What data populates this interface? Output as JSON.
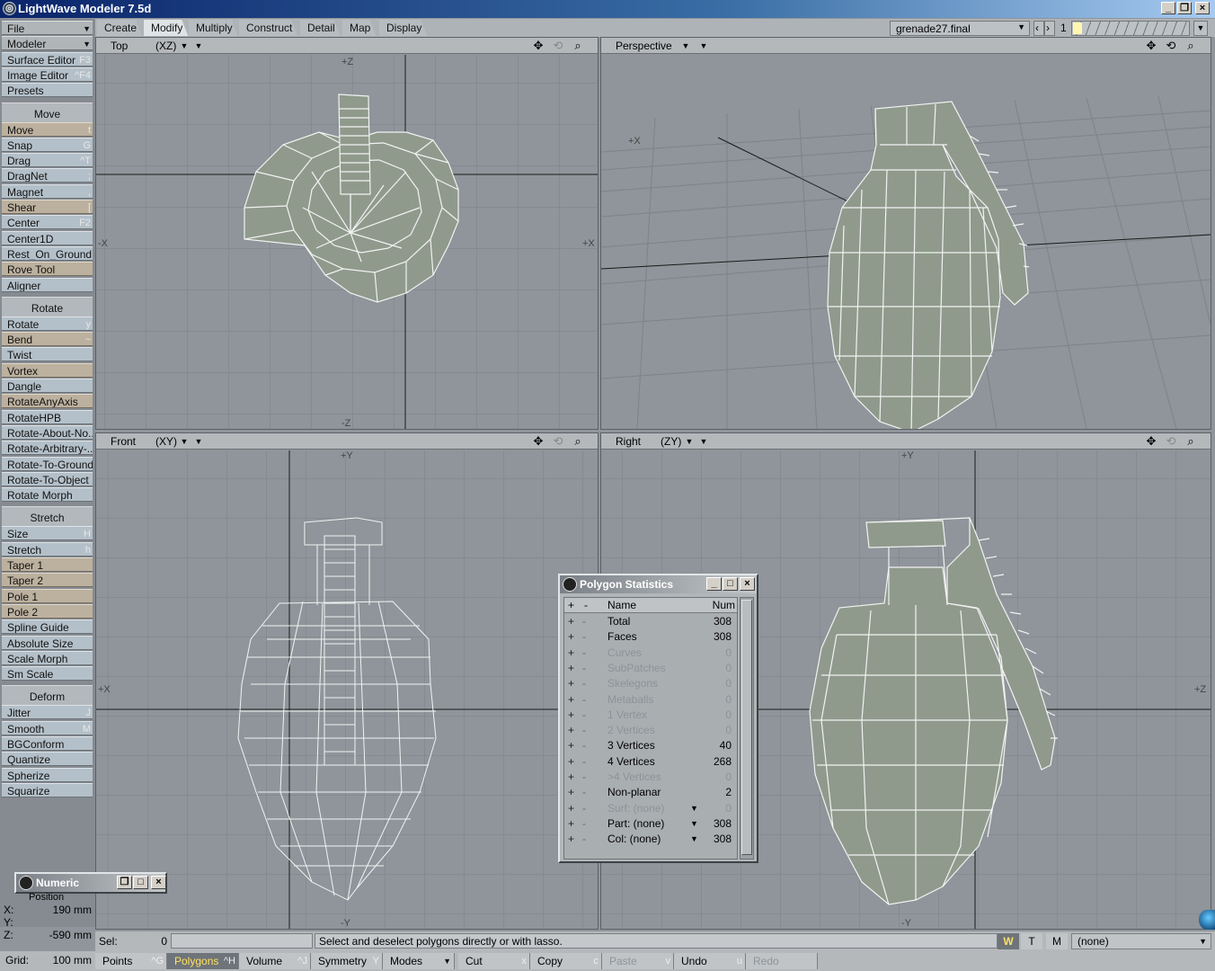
{
  "window": {
    "title": "LightWave Modeler 7.5d"
  },
  "tabs": [
    "Create",
    "Modify",
    "Multiply",
    "Construct",
    "Detail",
    "Map",
    "Display"
  ],
  "active_tab": "Modify",
  "scene": {
    "object": "grenade27.final",
    "layer": "1"
  },
  "sidebar": {
    "top": [
      {
        "label": "File",
        "shortcut": ""
      },
      {
        "label": "Modeler",
        "shortcut": ""
      },
      {
        "label": "Surface Editor",
        "shortcut": "F3"
      },
      {
        "label": "Image Editor",
        "shortcut": "^F4"
      },
      {
        "label": "Presets",
        "shortcut": ""
      }
    ],
    "move_header": "Move",
    "move": [
      {
        "label": "Move",
        "shortcut": "t"
      },
      {
        "label": "Snap",
        "shortcut": "G"
      },
      {
        "label": "Drag",
        "shortcut": "^T"
      },
      {
        "label": "DragNet",
        "shortcut": ";"
      },
      {
        "label": "Magnet",
        "shortcut": ","
      },
      {
        "label": "Shear",
        "shortcut": "["
      },
      {
        "label": "Center",
        "shortcut": "F2"
      },
      {
        "label": "Center1D",
        "shortcut": ""
      },
      {
        "label": "Rest_On_Ground",
        "shortcut": ""
      },
      {
        "label": "Rove Tool",
        "shortcut": ""
      },
      {
        "label": "Aligner",
        "shortcut": ""
      }
    ],
    "rotate_header": "Rotate",
    "rotate": [
      {
        "label": "Rotate",
        "shortcut": "y"
      },
      {
        "label": "Bend",
        "shortcut": "~"
      },
      {
        "label": "Twist",
        "shortcut": ""
      },
      {
        "label": "Vortex",
        "shortcut": ""
      },
      {
        "label": "Dangle",
        "shortcut": ""
      },
      {
        "label": "RotateAnyAxis",
        "shortcut": ""
      },
      {
        "label": "RotateHPB",
        "shortcut": ""
      },
      {
        "label": "Rotate-About-No...",
        "shortcut": ""
      },
      {
        "label": "Rotate-Arbitrary-...",
        "shortcut": ""
      },
      {
        "label": "Rotate-To-Ground",
        "shortcut": ""
      },
      {
        "label": "Rotate-To-Object",
        "shortcut": ""
      },
      {
        "label": "Rotate Morph",
        "shortcut": ""
      }
    ],
    "stretch_header": "Stretch",
    "stretch": [
      {
        "label": "Size",
        "shortcut": "H"
      },
      {
        "label": "Stretch",
        "shortcut": "h"
      },
      {
        "label": "Taper 1",
        "shortcut": ""
      },
      {
        "label": "Taper 2",
        "shortcut": ""
      },
      {
        "label": "Pole 1",
        "shortcut": ""
      },
      {
        "label": "Pole 2",
        "shortcut": ""
      },
      {
        "label": "Spline Guide",
        "shortcut": ""
      },
      {
        "label": "Absolute Size",
        "shortcut": ""
      },
      {
        "label": "Scale Morph",
        "shortcut": ""
      },
      {
        "label": "Sm Scale",
        "shortcut": ""
      }
    ],
    "deform_header": "Deform",
    "deform": [
      {
        "label": "Jitter",
        "shortcut": "J"
      },
      {
        "label": "Smooth",
        "shortcut": "M"
      },
      {
        "label": "BGConform",
        "shortcut": ""
      },
      {
        "label": "Quantize",
        "shortcut": ""
      },
      {
        "label": "Spherize",
        "shortcut": ""
      },
      {
        "label": "Squarize",
        "shortcut": ""
      }
    ]
  },
  "viewports": {
    "top": {
      "name": "Top",
      "axis": "(XZ)",
      "labels": [
        "+Z",
        "-Z",
        "-X",
        "+X"
      ]
    },
    "perspective": {
      "name": "Perspective",
      "axis": "",
      "labels": [
        "+X"
      ]
    },
    "front": {
      "name": "Front",
      "axis": "(XY)",
      "labels": [
        "+Y",
        "-Y",
        "+X"
      ]
    },
    "right": {
      "name": "Right",
      "axis": "(ZY)",
      "labels": [
        "+Y",
        "-Y",
        "+Z"
      ]
    }
  },
  "numeric": {
    "title": "Numeric",
    "section": "Position",
    "x_label": "X:",
    "x_value": "190 mm",
    "y_label": "Y:",
    "y_value": "",
    "z_label": "Z:",
    "z_value": "-590 mm"
  },
  "polygon_stats": {
    "title": "Polygon Statistics",
    "col_plus": "+",
    "col_minus": "-",
    "col_name": "Name",
    "col_num": "Num",
    "rows": [
      {
        "name": "Total",
        "num": "308",
        "dim": false
      },
      {
        "name": "Faces",
        "num": "308",
        "dim": false
      },
      {
        "name": "Curves",
        "num": "0",
        "dim": true
      },
      {
        "name": "SubPatches",
        "num": "0",
        "dim": true
      },
      {
        "name": "Skelegons",
        "num": "0",
        "dim": true
      },
      {
        "name": "Metaballs",
        "num": "0",
        "dim": true
      },
      {
        "name": "1 Vertex",
        "num": "0",
        "dim": true
      },
      {
        "name": "2 Vertices",
        "num": "0",
        "dim": true
      },
      {
        "name": "3 Vertices",
        "num": "40",
        "dim": false
      },
      {
        "name": "4 Vertices",
        "num": "268",
        "dim": false
      },
      {
        "name": ">4 Vertices",
        "num": "0",
        "dim": true
      },
      {
        "name": "Non-planar",
        "num": "2",
        "dim": false
      },
      {
        "name": "Surf: (none)",
        "num": "0",
        "dim": true
      },
      {
        "name": "Part: (none)",
        "num": "308",
        "dim": false
      },
      {
        "name": "Col: (none)",
        "num": "308",
        "dim": false
      }
    ]
  },
  "status": {
    "sel_label": "Sel:",
    "sel_value": "0",
    "message": "Select and deselect polygons directly or with lasso.",
    "w": "W",
    "t": "T",
    "m": "M",
    "layer_dropdown": "(none)"
  },
  "bottom": {
    "grid_label": "Grid:",
    "grid_value": "100 mm",
    "points": "Points",
    "points_key": "^G",
    "polygons": "Polygons",
    "polygons_key": "^H",
    "volume": "Volume",
    "volume_key": "^J",
    "symmetry": "Symmetry",
    "symmetry_key": "Y",
    "modes": "Modes",
    "cut": "Cut",
    "cut_key": "x",
    "copy": "Copy",
    "copy_key": "c",
    "paste": "Paste",
    "paste_key": "v",
    "undo": "Undo",
    "undo_key": "u",
    "redo": "Redo"
  },
  "colors": {
    "mesh_fill": "#8f9a8c",
    "wire": "#f2f2f2",
    "grid": "#7b8185",
    "axis": "#1a1a1a",
    "active_tab": "#dfe3e6"
  }
}
